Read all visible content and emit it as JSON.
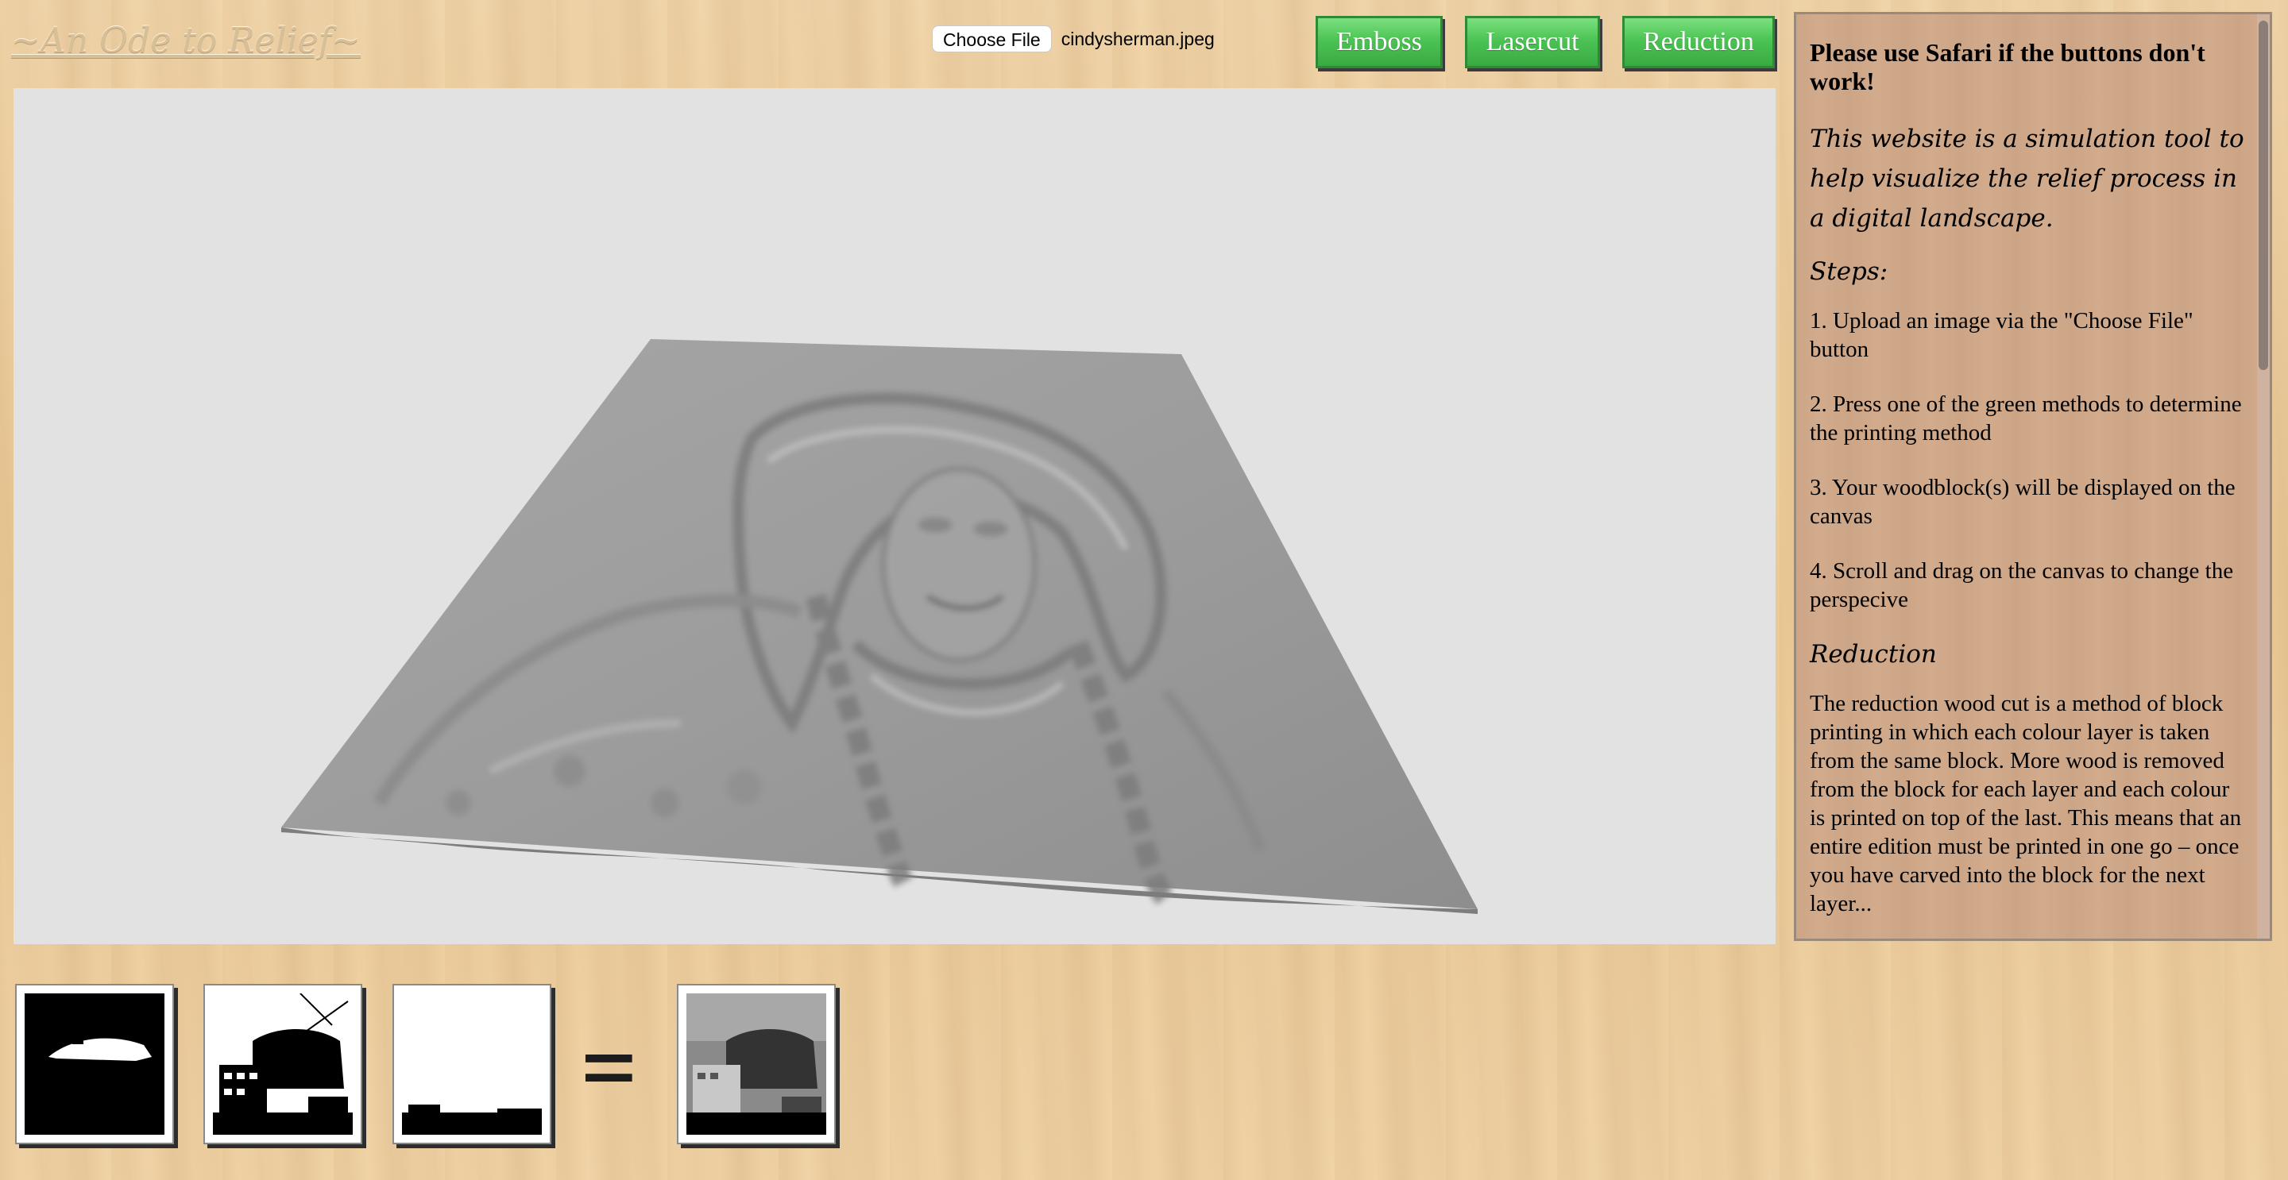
{
  "header": {
    "logo_text": "~An Ode to Relief~",
    "choose_file_label": "Choose File",
    "file_name": "cindysherman.jpeg",
    "buttons": {
      "emboss": "Emboss",
      "lasercut": "Lasercut",
      "reduction": "Reduction"
    }
  },
  "info": {
    "warning": "Please use Safari if the buttons don't work!",
    "intro": "This website is a simulation tool to help visualize the relief process in a digital landscape.",
    "steps_heading": "Steps:",
    "steps": [
      "1. Upload an image via the \"Choose File\" button",
      "2. Press one of the green methods to determine the printing method",
      "3. Your woodblock(s) will be displayed on the canvas",
      "4. Scroll and drag on the canvas to change the perspecive"
    ],
    "section_heading": "Reduction",
    "section_text": "The reduction wood cut is a method of block printing in which each colour layer is taken from the same block. More wood is removed from the block for each layer and each colour is printed on top of the last. This means that an entire edition must be printed in one go – once you have carved into the block for the next layer..."
  },
  "layers": {
    "equals_sign": "="
  },
  "colors": {
    "button_green": "#4cc454",
    "canvas_bg": "#e2e2e2",
    "panel_bg": "#d2aa8c"
  }
}
